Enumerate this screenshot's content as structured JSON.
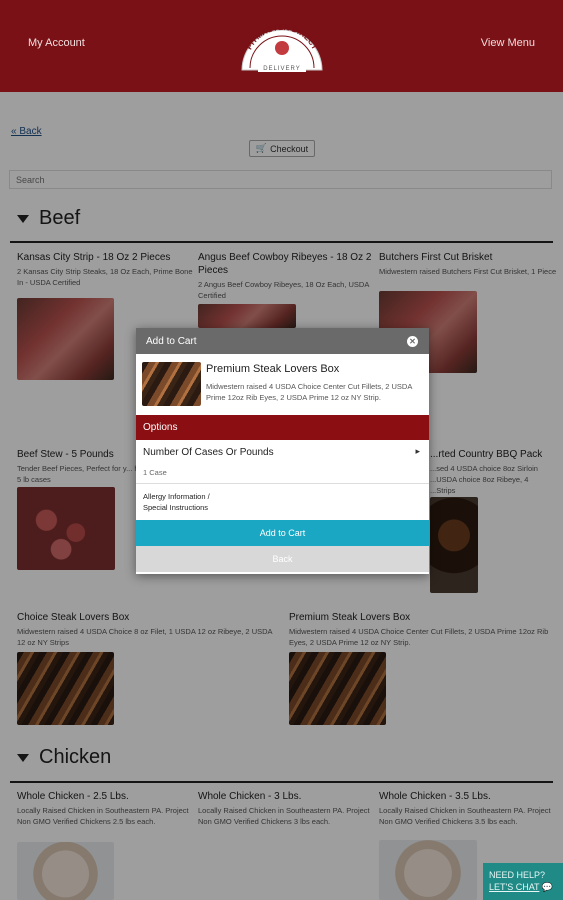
{
  "header": {
    "account_label": "My Account",
    "menu_label": "View Menu",
    "logo": {
      "brand": "PITMASTER DIRECT",
      "tagline": "DELIVERY",
      "brand_color": "#7a1116"
    }
  },
  "nav": {
    "back_label": "« Back",
    "checkout_label": "Checkout",
    "checkout_icon": "cart-icon",
    "search_placeholder": "Search"
  },
  "sections": {
    "beef": {
      "title": "Beef",
      "items": [
        {
          "name": "Kansas City Strip - 18 Oz 2 Pieces",
          "desc": "2 Kansas City Strip Steaks, 18 Oz Each, Prime Bone In - USDA Certified"
        },
        {
          "name": "Angus Beef Cowboy Ribeyes - 18 Oz 2 Pieces",
          "desc": "2 Angus Beef Cowboy Ribeyes, 18 Oz Each, USDA Certified"
        },
        {
          "name": "Butchers First Cut Brisket",
          "desc": "Midwestern raised Butchers First Cut Brisket, 1 Piece"
        },
        {
          "name": "Beef Stew - 5 Pounds",
          "desc": "Tender Beef Pieces, Perfect for y... homemade stew, 5 lb cases"
        },
        {
          "name": "...rted Country BBQ Pack",
          "desc": "...sed 4 USDA choice 8oz Sirloin ...USDA choice 8oz Ribeye, 4 ...Strips"
        },
        {
          "name": "Choice Steak Lovers Box",
          "desc": "Midwestern raised 4 USDA Choice 8 oz Filet, 1 USDA 12 oz Ribeye, 2 USDA 12 oz NY Strips"
        },
        {
          "name": "Premium Steak Lovers Box",
          "desc": "Midwestern raised 4 USDA Choice Center Cut Fillets, 2 USDA Prime 12oz Rib Eyes, 2 USDA Prime 12 oz NY Strip."
        }
      ]
    },
    "chicken": {
      "title": "Chicken",
      "items": [
        {
          "name": "Whole Chicken - 2.5 Lbs.",
          "desc": "Locally Raised Chicken in Southeastern PA. Project Non GMO Verified Chickens 2.5 lbs each."
        },
        {
          "name": "Whole Chicken - 3 Lbs.",
          "desc": "Locally Raised Chicken in Southeastern PA. Project Non GMO Verified Chickens 3 lbs each."
        },
        {
          "name": "Whole Chicken - 3.5 Lbs.",
          "desc": "Locally Raised Chicken in Southeastern PA. Project Non GMO Verified Chickens 3.5 lbs each."
        }
      ]
    }
  },
  "modal": {
    "title": "Add to Cart",
    "close_icon": "close-icon",
    "product_name": "Premium Steak Lovers Box",
    "product_desc": "Midwestern raised 4 USDA Choice Center Cut Fillets, 2 USDA Prime 12oz Rib Eyes, 2 USDA Prime 12 oz NY Strip.",
    "options_label": "Options",
    "option_label": "Number Of Cases Or Pounds",
    "option_value": "1 Case",
    "allergy_line1": "Allergy Information /",
    "allergy_line2": "Special Instructions",
    "add_label": "Add to Cart",
    "back_label": "Back",
    "accent_color": "#19a7c4",
    "options_color": "#8a0e12"
  },
  "help": {
    "line1": "NEED HELP?",
    "line2": "LET'S CHAT",
    "icon": "chat-icon"
  }
}
